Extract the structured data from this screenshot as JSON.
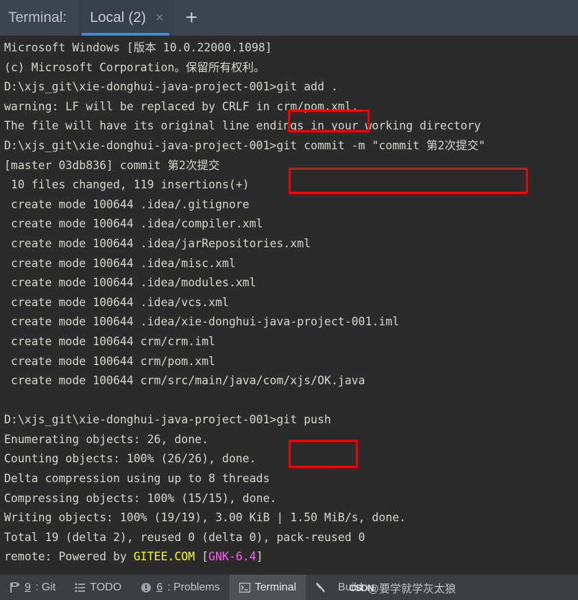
{
  "window": {
    "title_label": "Terminal:",
    "tab": {
      "label": "Local (2)",
      "close_icon": "close-icon",
      "close_glyph": "×"
    },
    "add_tab_glyph": "+",
    "accent_color": "#4a88c7",
    "header_bg": "#3c4452",
    "terminal_bg": "#2b2b2b"
  },
  "terminal": {
    "lines": [
      {
        "text": "Microsoft Windows [版本 10.0.22000.1098]"
      },
      {
        "text": "(c) Microsoft Corporation。保留所有权利。"
      },
      {
        "text": "D:\\xjs_git\\xie-donghui-java-project-001>git add ."
      },
      {
        "text": "warning: LF will be replaced by CRLF in crm/pom.xml."
      },
      {
        "text": "The file will have its original line endings in your working directory"
      },
      {
        "text": "D:\\xjs_git\\xie-donghui-java-project-001>git commit -m \"commit 第2次提交\""
      },
      {
        "text": "[master 03db836] commit 第2次提交"
      },
      {
        "text": " 10 files changed, 119 insertions(+)"
      },
      {
        "text": " create mode 100644 .idea/.gitignore"
      },
      {
        "text": " create mode 100644 .idea/compiler.xml"
      },
      {
        "text": " create mode 100644 .idea/jarRepositories.xml"
      },
      {
        "text": " create mode 100644 .idea/misc.xml"
      },
      {
        "text": " create mode 100644 .idea/modules.xml"
      },
      {
        "text": " create mode 100644 .idea/vcs.xml"
      },
      {
        "text": " create mode 100644 .idea/xie-donghui-java-project-001.iml"
      },
      {
        "text": " create mode 100644 crm/crm.iml"
      },
      {
        "text": " create mode 100644 crm/pom.xml"
      },
      {
        "text": " create mode 100644 crm/src/main/java/com/xjs/OK.java"
      },
      {
        "text": ""
      },
      {
        "text": "D:\\xjs_git\\xie-donghui-java-project-001>git push"
      },
      {
        "text": "Enumerating objects: 26, done."
      },
      {
        "text": "Counting objects: 100% (26/26), done."
      },
      {
        "text": "Delta compression using up to 8 threads"
      },
      {
        "text": "Compressing objects: 100% (15/15), done."
      },
      {
        "text": "Writing objects: 100% (19/19), 3.00 KiB | 1.50 MiB/s, done."
      },
      {
        "text": "Total 19 (delta 2), reused 0 (delta 0), pack-reused 0"
      }
    ],
    "last_line": {
      "prefix": "remote: Powered by ",
      "gitee": "GITEE.COM",
      "space": " ",
      "bracket_open": "[",
      "gnk": "GNK-6.4",
      "bracket_close": "]",
      "gitee_color": "#ffff00",
      "gnk_color": "#ff5ff5"
    },
    "annotations": [
      {
        "name": "git add .",
        "label": "git add ."
      },
      {
        "name": "git commit",
        "label": "git commit -m \"commit 第2次提交\""
      },
      {
        "name": "git push",
        "label": "git push"
      }
    ],
    "annotation_color": "#f50000"
  },
  "statusbar": {
    "git": {
      "number": "9",
      "label": ": Git",
      "icon": "git-branch-icon"
    },
    "todo": {
      "label": "TODO",
      "icon": "list-icon"
    },
    "problems": {
      "number": "6",
      "label": ": Problems",
      "icon": "warning-circle-icon"
    },
    "terminal": {
      "label": "Terminal",
      "icon": "terminal-icon"
    },
    "build": {
      "label": "Build",
      "icon": "hammer-icon"
    },
    "watermark": {
      "csdn": "CSDN",
      "handle": "@要学就学灰太狼"
    }
  }
}
